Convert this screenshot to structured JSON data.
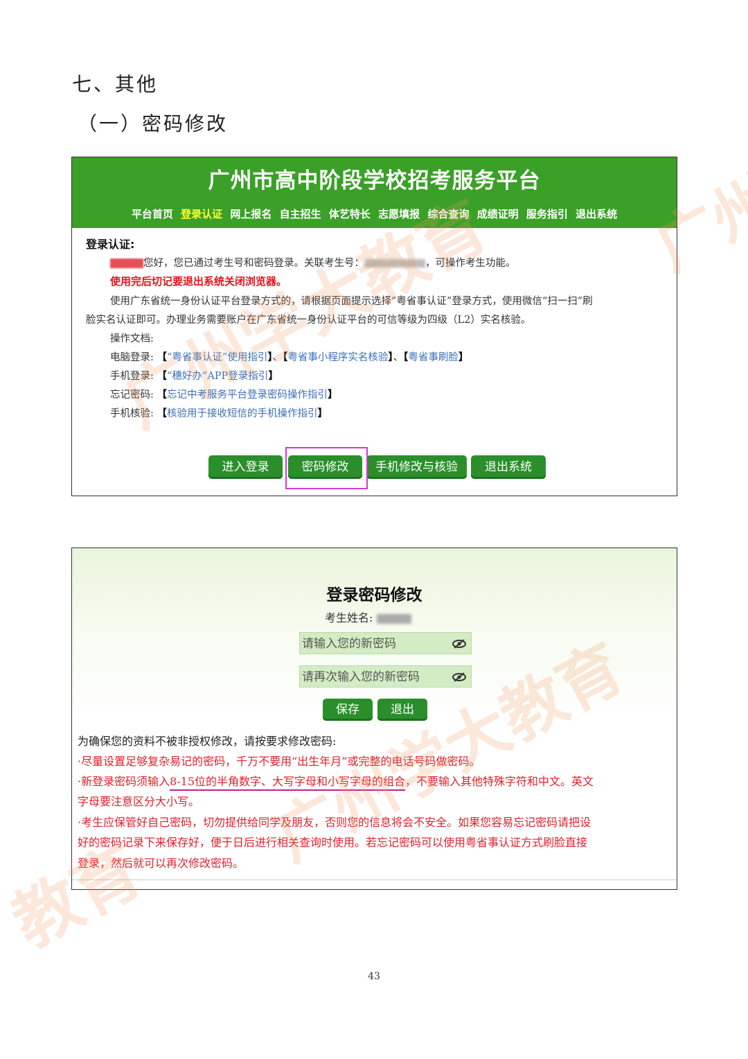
{
  "document": {
    "heading1": "七、其他",
    "heading2": "（一）密码修改",
    "page_number": "43"
  },
  "screenshot1": {
    "title": "广州市高中阶段学校招考服务平台",
    "nav": [
      "平台首页",
      "登录认证",
      "网上报名",
      "自主招生",
      "体艺特长",
      "志愿填报",
      "综合查询",
      "成绩证明",
      "服务指引",
      "退出系统"
    ],
    "active_nav": "登录认证",
    "section_label": "登录认证:",
    "greeting": "您好，您已通过考生号和密码登录。关联考生号：",
    "greeting_tail": "，可操作考生功能。",
    "warning": "使用完后切记要退出系统关闭浏览器。",
    "para1": "使用广东省统一身份认证平台登录方式的，请根据页面提示选择“粤省事认证”登录方式，使用微信“扫一扫”刷",
    "para2": "脸实名认证即可。办理业务需要账户在广东省统一身份认证平台的可信等级为四级（L2）实名核验。",
    "docs_label": "操作文档:",
    "rows": [
      {
        "label": "电脑登录:",
        "links": [
          "“粤省事认证”使用指引",
          "粤省事小程序实名核验",
          "粤省事刷脸"
        ]
      },
      {
        "label": "手机登录:",
        "links": [
          "“穗好办”APP登录指引"
        ]
      },
      {
        "label": "忘记密码:",
        "links": [
          "忘记中考服务平台登录密码操作指引"
        ]
      },
      {
        "label": "手机核验:",
        "links": [
          "核验用于接收短信的手机操作指引"
        ]
      }
    ],
    "buttons": {
      "login": "进入登录",
      "change_password": "密码修改",
      "phone": "手机修改与核验",
      "logout": "退出系统"
    }
  },
  "screenshot2": {
    "title": "登录密码修改",
    "name_label": "考生姓名:",
    "new_password_placeholder": "请输入您的新密码",
    "confirm_password_placeholder": "请再次输入您的新密码",
    "save_label": "保存",
    "exit_label": "退出",
    "notice_title": "为确保您的资料不被非授权修改，请按要求修改密码:",
    "rule1": "·尽量设置足够复杂易记的密码，千万不要用“出生年月”或完整的电话号码做密码。",
    "rule2_pre": "·新登录密码须输入",
    "rule2_underline": "8-15位的半角数字、大写字母和小写字母的组合",
    "rule2_post": "，不要输入其他特殊字符和中文。英文",
    "rule2_line2": "字母要注意区分大小写。",
    "rule3_line1": "·考生应保管好自己密码，切勿提供给同学及朋友，否则您的信息将会不安全。如果您容易忘记密码请把设",
    "rule3_line2": "好的密码记录下来保存好，便于日后进行相关查询时使用。若忘记密码可以使用粤省事认证方式刷脸直接",
    "rule3_line3": "登录，然后就可以再次修改密码。"
  },
  "watermark": {
    "text_a": "广州学大教育",
    "text_b": "广州学大教育",
    "text_c": "教育",
    "text_d": "广州"
  },
  "icons": {
    "eye": "eye-slash-icon"
  }
}
